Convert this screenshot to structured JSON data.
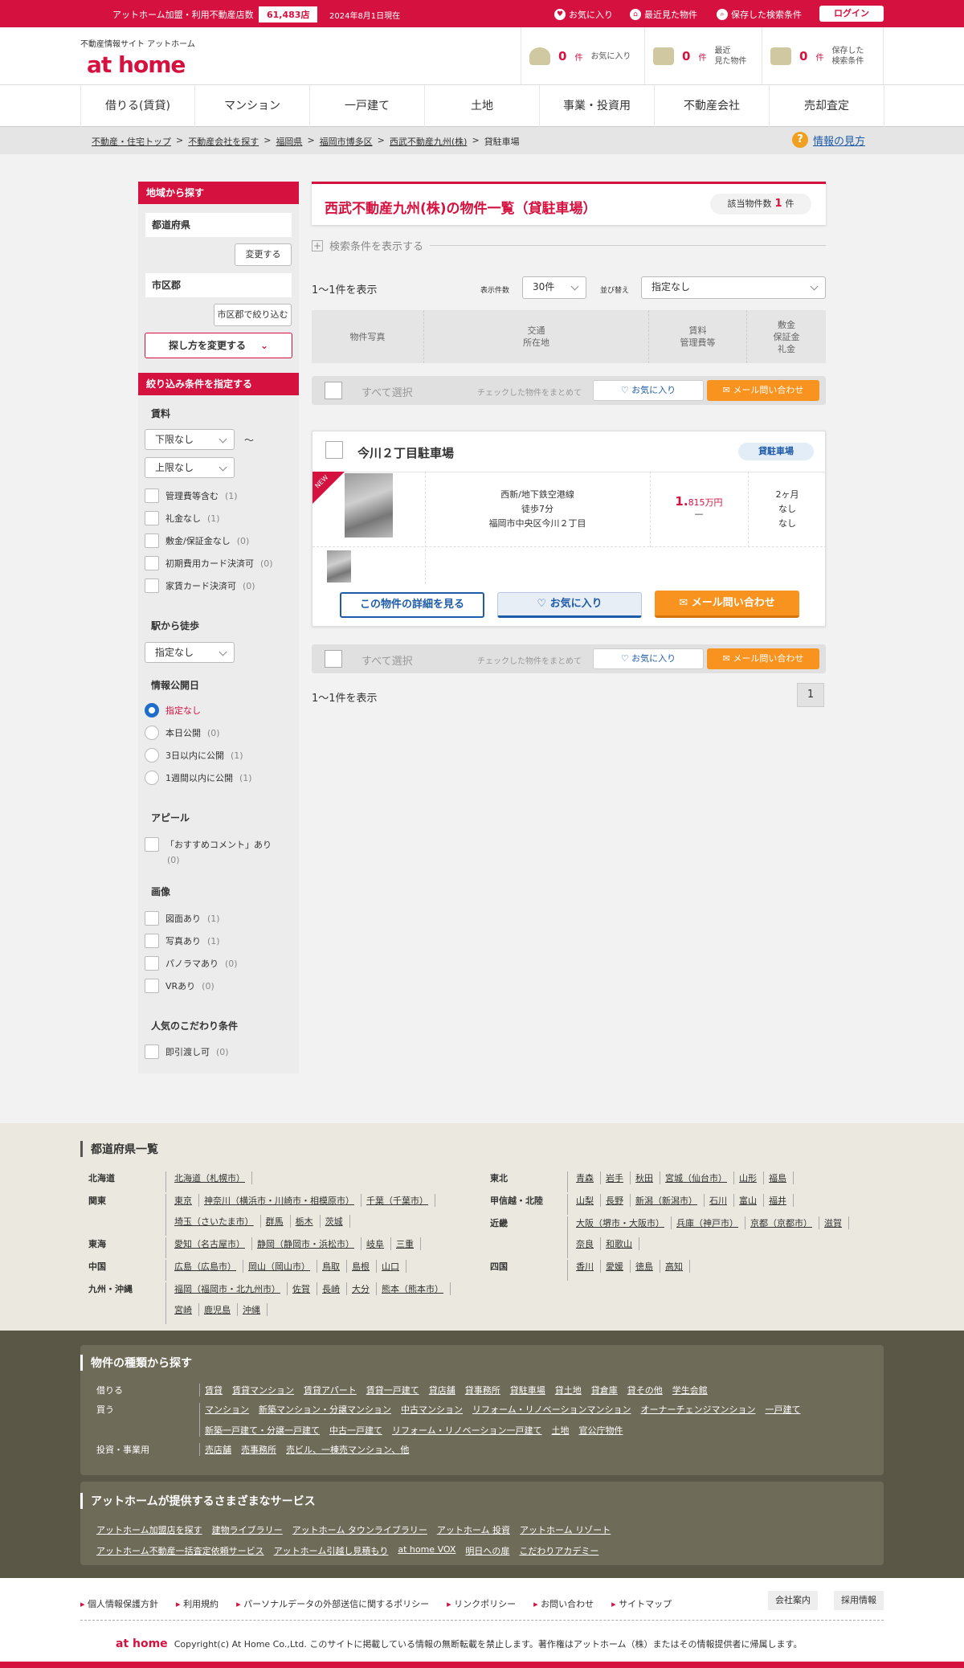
{
  "topbar": {
    "label": "アットホーム加盟・利用不動産店数",
    "count": "61,483店",
    "date": "2024年8月1日現在",
    "links": [
      "お気に入り",
      "最近見た物件",
      "保存した検索条件"
    ],
    "login": "ログイン"
  },
  "header": {
    "tagline": "不動産情報サイト アットホーム",
    "logo": "at home",
    "boxes": [
      {
        "count": "0",
        "unit": "件",
        "label": "お気に入り"
      },
      {
        "count": "0",
        "unit": "件",
        "label": "最近\n見た物件"
      },
      {
        "count": "0",
        "unit": "件",
        "label": "保存した\n検索条件"
      }
    ]
  },
  "nav": [
    "借りる(賃貸)",
    "マンション",
    "一戸建て",
    "土地",
    "事業・投資用",
    "不動産会社",
    "売却査定"
  ],
  "breadcrumb": [
    "不動産・住宅トップ",
    "不動産会社を探す",
    "福岡県",
    "福岡市博多区",
    "西武不動産九州(株)",
    "貸駐車場"
  ],
  "help": "情報の見方",
  "sidebar": {
    "area_head": "地域から探す",
    "pref_label": "都道府県",
    "change_btn": "変更する",
    "city_label": "市区郡",
    "city_btn": "市区郡で絞り込む",
    "method_btn": "探し方を変更する",
    "filter_head": "絞り込み条件を指定する",
    "rent_title": "賃料",
    "rent_min": "下限なし",
    "tilde": "〜",
    "rent_max": "上限なし",
    "rent_checks": [
      {
        "label": "管理費等含む",
        "count": "(1)"
      },
      {
        "label": "礼金なし",
        "count": "(1)"
      },
      {
        "label": "敷金/保証金なし",
        "count": "(0)"
      },
      {
        "label": "初期費用カード決済可",
        "count": "(0)"
      },
      {
        "label": "家賃カード決済可",
        "count": "(0)"
      }
    ],
    "walk_title": "駅から徒歩",
    "walk_sel": "指定なし",
    "pub_title": "情報公開日",
    "pub_radios": [
      {
        "label": "指定なし",
        "count": ""
      },
      {
        "label": "本日公開",
        "count": "(0)"
      },
      {
        "label": "3日以内に公開",
        "count": "(1)"
      },
      {
        "label": "1週間以内に公開",
        "count": "(1)"
      }
    ],
    "appeal_title": "アピール",
    "appeal_label": "「おすすめコメント」あり",
    "appeal_count": "(0)",
    "image_title": "画像",
    "image_checks": [
      {
        "label": "図面あり",
        "count": "(1)"
      },
      {
        "label": "写真あり",
        "count": "(1)"
      },
      {
        "label": "パノラマあり",
        "count": "(0)"
      },
      {
        "label": "VRあり",
        "count": "(0)"
      }
    ],
    "pop_title": "人気のこだわり条件",
    "pop_label": "即引渡し可",
    "pop_count": "(0)"
  },
  "main": {
    "title": "西武不動産九州(株)の物件一覧（貸駐車場）",
    "count_label": "該当物件数",
    "count": "1",
    "count_unit": "件",
    "search_toggle": "検索条件を表示する",
    "showing": "1〜1件を表示",
    "perpage_label": "表示件数",
    "perpage": "30件",
    "sort_label": "並び替え",
    "sort": "指定なし",
    "th_photo": "物件写真",
    "th_access": "交通\n所在地",
    "th_rent": "賃料\n管理費等",
    "th_deposit": "敷金\n保証金\n礼金",
    "select_all": "すべて選択",
    "select_note": "チェックした物件をまとめて",
    "fav": "お気に入り",
    "mail": "メール問い合わせ",
    "page": "1"
  },
  "card": {
    "name": "今川２丁目駐車場",
    "badge": "貸駐車場",
    "new": "NEW",
    "line": "西新/地下鉄空港線",
    "walk": "徒歩7分",
    "address": "福岡市中央区今川２丁目",
    "price_int": "1.",
    "price_dec": "815万円",
    "mgmt": "—",
    "deposit": "2ヶ月",
    "guarantee": "なし",
    "key": "なし",
    "detail_btn": "この物件の詳細を見る",
    "fav_btn": "お気に入り",
    "mail_btn": "メール問い合わせ"
  },
  "pref_section": {
    "title": "都道府県一覧",
    "left": [
      {
        "region": "北海道",
        "items": [
          "北海道（札幌市）"
        ]
      },
      {
        "region": "関東",
        "items": [
          "東京",
          "神奈川（横浜市・川崎市・相模原市）",
          "千葉（千葉市）",
          "埼玉（さいたま市）",
          "群馬",
          "栃木",
          "茨城"
        ]
      },
      {
        "region": "東海",
        "items": [
          "愛知（名古屋市）",
          "静岡（静岡市・浜松市）",
          "岐阜",
          "三重"
        ]
      },
      {
        "region": "中国",
        "items": [
          "広島（広島市）",
          "岡山（岡山市）",
          "鳥取",
          "島根",
          "山口"
        ]
      },
      {
        "region": "九州・沖縄",
        "items": [
          "福岡（福岡市・北九州市）",
          "佐賀",
          "長崎",
          "大分",
          "熊本（熊本市）",
          "宮崎",
          "鹿児島",
          "沖縄"
        ]
      }
    ],
    "right": [
      {
        "region": "東北",
        "items": [
          "青森",
          "岩手",
          "秋田",
          "宮城（仙台市）",
          "山形",
          "福島"
        ]
      },
      {
        "region": "甲信越・北陸",
        "items": [
          "山梨",
          "長野",
          "新潟（新潟市）",
          "石川",
          "富山",
          "福井"
        ]
      },
      {
        "region": "近畿",
        "items": [
          "大阪（堺市・大阪市）",
          "兵庫（神戸市）",
          "京都（京都市）",
          "滋賀",
          "奈良",
          "和歌山"
        ]
      },
      {
        "region": "四国",
        "items": [
          "香川",
          "愛媛",
          "徳島",
          "高知"
        ]
      }
    ]
  },
  "types_section": {
    "title": "物件の種類から探す",
    "rows": [
      {
        "label": "借りる",
        "items": [
          "賃貸",
          "賃貸マンション",
          "賃貸アパート",
          "賃貸一戸建て",
          "貸店舗",
          "貸事務所",
          "貸駐車場",
          "貸土地",
          "貸倉庫",
          "貸その他",
          "学生会館"
        ]
      },
      {
        "label": "買う",
        "items": [
          "マンション",
          "新築マンション・分譲マンション",
          "中古マンション",
          "リフォーム・リノベーションマンション",
          "オーナーチェンジマンション",
          "一戸建て",
          "新築一戸建て・分譲一戸建て",
          "中古一戸建て",
          "リフォーム・リノベーション一戸建て",
          "土地",
          "官公庁物件"
        ]
      },
      {
        "label": "投資・事業用",
        "items": [
          "売店舗",
          "売事務所",
          "売ビル、一棟売マンション、他"
        ]
      }
    ]
  },
  "services_section": {
    "title": "アットホームが提供するさまざまなサービス",
    "items": [
      "アットホーム加盟店を探す",
      "建物ライブラリー",
      "アットホーム タウンライブラリー",
      "アットホーム 投資",
      "アットホーム リゾート",
      "アットホーム不動産一括査定依頼サービス",
      "アットホーム引越し見積もり",
      "at home VOX",
      "明日への扉",
      "こだわりアカデミー"
    ]
  },
  "footer": {
    "links": [
      "個人情報保護方針",
      "利用規約",
      "パーソナルデータの外部送信に関するポリシー",
      "リンクポリシー",
      "お問い合わせ",
      "サイトマップ"
    ],
    "company": "会社案内",
    "recruit": "採用情報",
    "logo": "at home",
    "copyright": "Copyright(c) At Home Co.,Ltd. このサイトに掲載している情報の無断転載を禁止します。著作権はアットホーム（株）またはその情報提供者に帰属します。"
  },
  "colors": {
    "brand": "#d5113f",
    "accent": "#f7931e",
    "link_blue": "#1e5ba8"
  }
}
